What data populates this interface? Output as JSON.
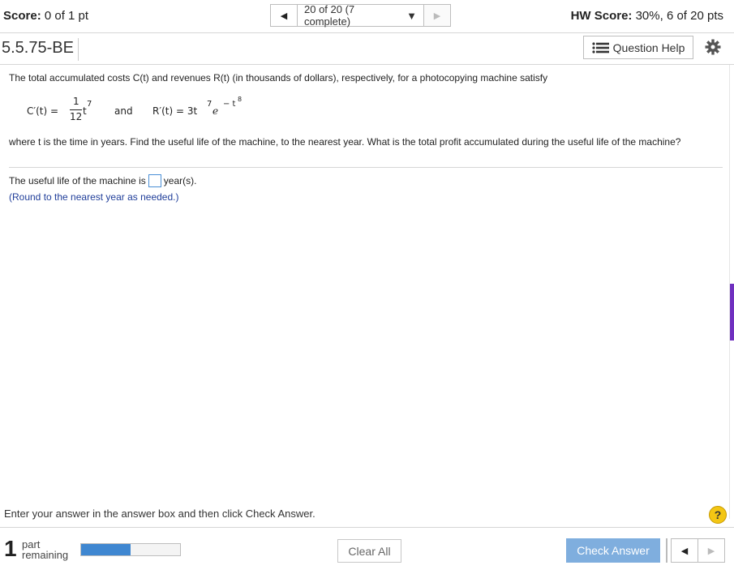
{
  "header": {
    "score_label": "Score:",
    "score_value": "0 of 1 pt",
    "nav_prev_icon": "triangle-left-icon",
    "nav_status": "20 of 20 (7 complete)",
    "nav_dropdown_icon": "triangle-down-icon",
    "nav_next_icon": "triangle-right-icon",
    "hw_label": "HW Score:",
    "hw_value": "30%, 6 of 20 pts"
  },
  "question_bar": {
    "question_id": "5.5.75-BE",
    "help_label": "Question Help",
    "help_icon": "list-icon",
    "settings_icon": "gear-icon"
  },
  "problem": {
    "intro": "The total accumulated costs C(t) and revenues R(t) (in thousands of dollars), respectively, for a photocopying machine satisfy",
    "c_lhs": "C′(t) =",
    "c_num": "1",
    "c_den": "12",
    "c_var": "t",
    "c_exp": "7",
    "and": "and",
    "r_lhs": "R′(t) = 3t",
    "r_exp": "7",
    "r_e": "e",
    "r_eexp": "− t",
    "r_eexp2": "8",
    "question": "where t is the time in years. Find the useful life of the machine, to the nearest year. What is the total profit accumulated during the useful life of the machine?",
    "answer_prefix": "The useful life of the machine is",
    "answer_suffix": "year(s).",
    "round_note": "(Round to the nearest year as needed.)"
  },
  "footer": {
    "instruction": "Enter your answer in the answer box and then click Check Answer.",
    "help_symbol": "?",
    "parts_count": "1",
    "parts_line1": "part",
    "parts_line2": "remaining",
    "progress_fraction": 0.5,
    "clear_label": "Clear All",
    "check_label": "Check Answer",
    "prev_icon": "triangle-left-icon",
    "next_icon": "triangle-right-icon"
  },
  "colors": {
    "accent": "#3f87d1",
    "check_button": "#7faede",
    "instruction_blue": "#1f3d99",
    "help_yellow": "#f3c614",
    "side_stripe": "#6f2fbf"
  }
}
